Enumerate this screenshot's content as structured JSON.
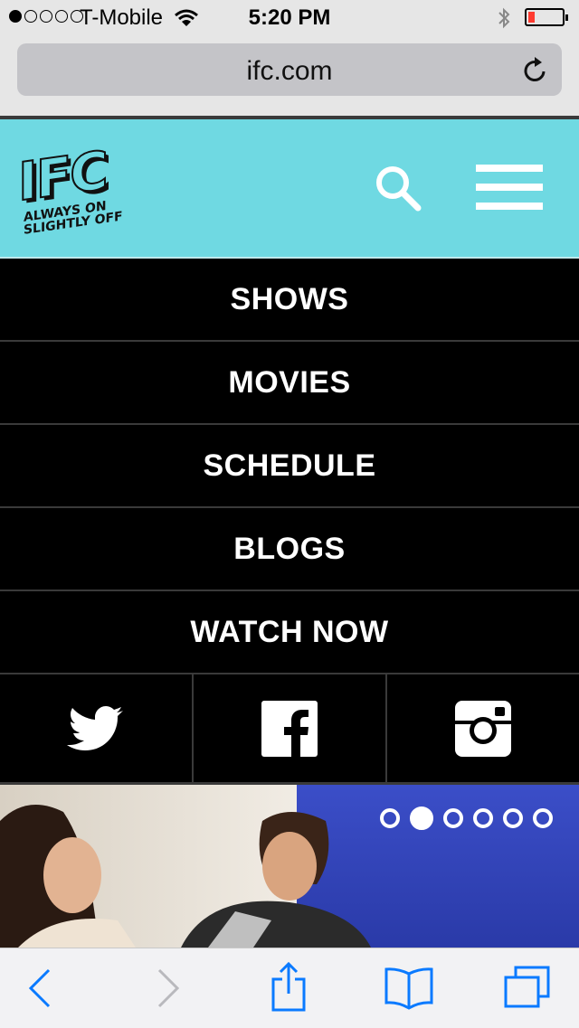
{
  "status_bar": {
    "carrier": "T-Mobile",
    "time": "5:20 PM",
    "signal_bars_filled": 1,
    "signal_bars_total": 5,
    "battery_level": 0.1,
    "battery_color": "#ff3b30"
  },
  "browser": {
    "url": "ifc.com"
  },
  "header": {
    "logo_text": "IFC",
    "tagline_line1": "ALWAYS ON",
    "tagline_line2": "SLIGHTLY OFF",
    "background_color": "#6fd9e2",
    "icons": [
      "search-icon",
      "hamburger-menu-icon"
    ]
  },
  "nav": {
    "items": [
      {
        "label": "SHOWS"
      },
      {
        "label": "MOVIES"
      },
      {
        "label": "SCHEDULE"
      },
      {
        "label": "BLOGS"
      },
      {
        "label": "WATCH NOW"
      }
    ]
  },
  "social": {
    "icons": [
      "twitter-icon",
      "facebook-icon",
      "instagram-icon"
    ]
  },
  "hero": {
    "slide_count": 6,
    "active_slide": 2
  },
  "toolbar": {
    "icons": [
      "back-icon",
      "forward-icon",
      "share-icon",
      "bookmarks-icon",
      "tabs-icon"
    ]
  }
}
